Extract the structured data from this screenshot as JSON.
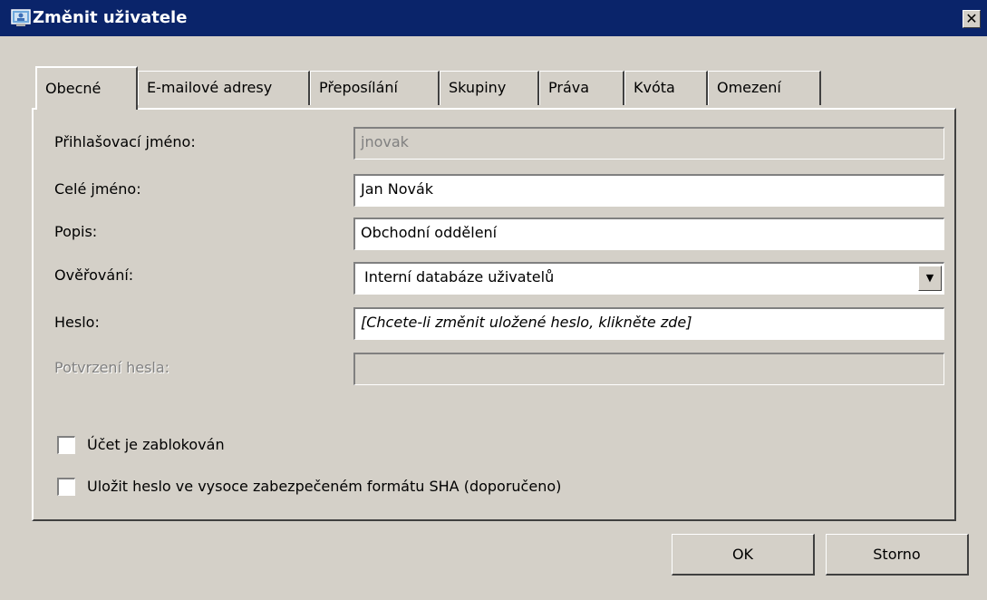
{
  "window": {
    "title": "Změnit uživatele",
    "close_glyph": "✕"
  },
  "tabs": [
    {
      "label": "Obecné",
      "active": true
    },
    {
      "label": "E-mailové adresy",
      "active": false
    },
    {
      "label": "Přeposílání",
      "active": false
    },
    {
      "label": "Skupiny",
      "active": false
    },
    {
      "label": "Práva",
      "active": false
    },
    {
      "label": "Kvóta",
      "active": false
    },
    {
      "label": "Omezení",
      "active": false
    }
  ],
  "form": {
    "login": {
      "label": "Přihlašovací jméno:",
      "value": "jnovak"
    },
    "fullname": {
      "label": "Celé jméno:",
      "value": "Jan Novák"
    },
    "description": {
      "label": "Popis:",
      "value": "Obchodní oddělení"
    },
    "auth": {
      "label": "Ověřování:",
      "value": "Interní databáze uživatelů",
      "arrow_glyph": "▼"
    },
    "password": {
      "label": "Heslo:",
      "value": "[Chcete-li změnit uložené heslo, klikněte zde]"
    },
    "confirm": {
      "label": "Potvrzení hesla:",
      "value": ""
    }
  },
  "checkboxes": {
    "blocked": {
      "label": "Účet je zablokován",
      "checked": false
    },
    "sha": {
      "label": "Uložit heslo ve vysoce zabezpečeném formátu SHA (doporučeno)",
      "checked": false
    }
  },
  "buttons": {
    "ok": "OK",
    "cancel": "Storno"
  },
  "colors": {
    "titlebar": "#0a246a",
    "face": "#d4d0c8"
  }
}
